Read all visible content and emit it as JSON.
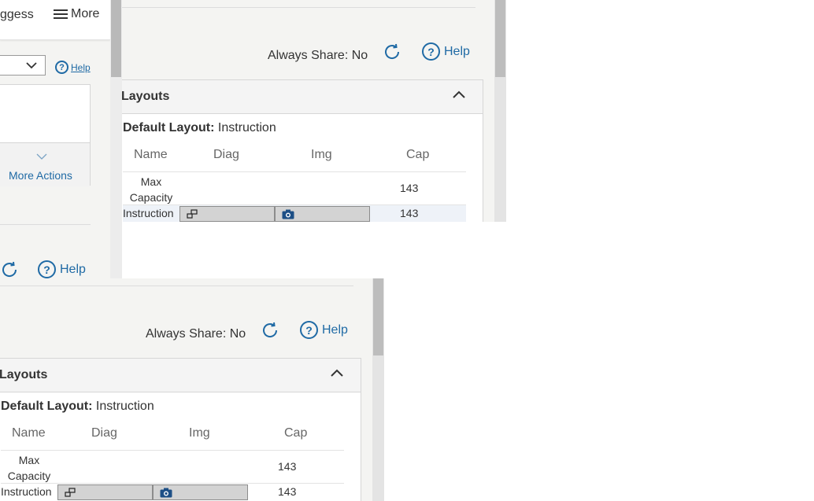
{
  "left": {
    "suggest_text": "ggess",
    "more_label": "More",
    "help_label": "Help",
    "more_actions_label": "More Actions"
  },
  "panel": {
    "always_share": "Always Share: No",
    "help_label": "Help",
    "layouts_title": "Layouts",
    "default_layout_label": "Default Layout:",
    "default_layout_value": "Instruction",
    "columns": [
      "Name",
      "Diag",
      "Img",
      "Cap"
    ],
    "rows": [
      {
        "name_line1": "Max",
        "name_line2": "Capacity",
        "cap": "143"
      },
      {
        "name": "Instruction",
        "cap": "143"
      }
    ]
  },
  "colors": {
    "link": "#1f6aa5",
    "panel_bg": "#f4f4f2"
  },
  "icons": [
    "hamburger-icon",
    "chevron-down-icon",
    "help-icon",
    "refresh-icon",
    "chevron-up-icon",
    "diagram-icon",
    "camera-icon"
  ]
}
